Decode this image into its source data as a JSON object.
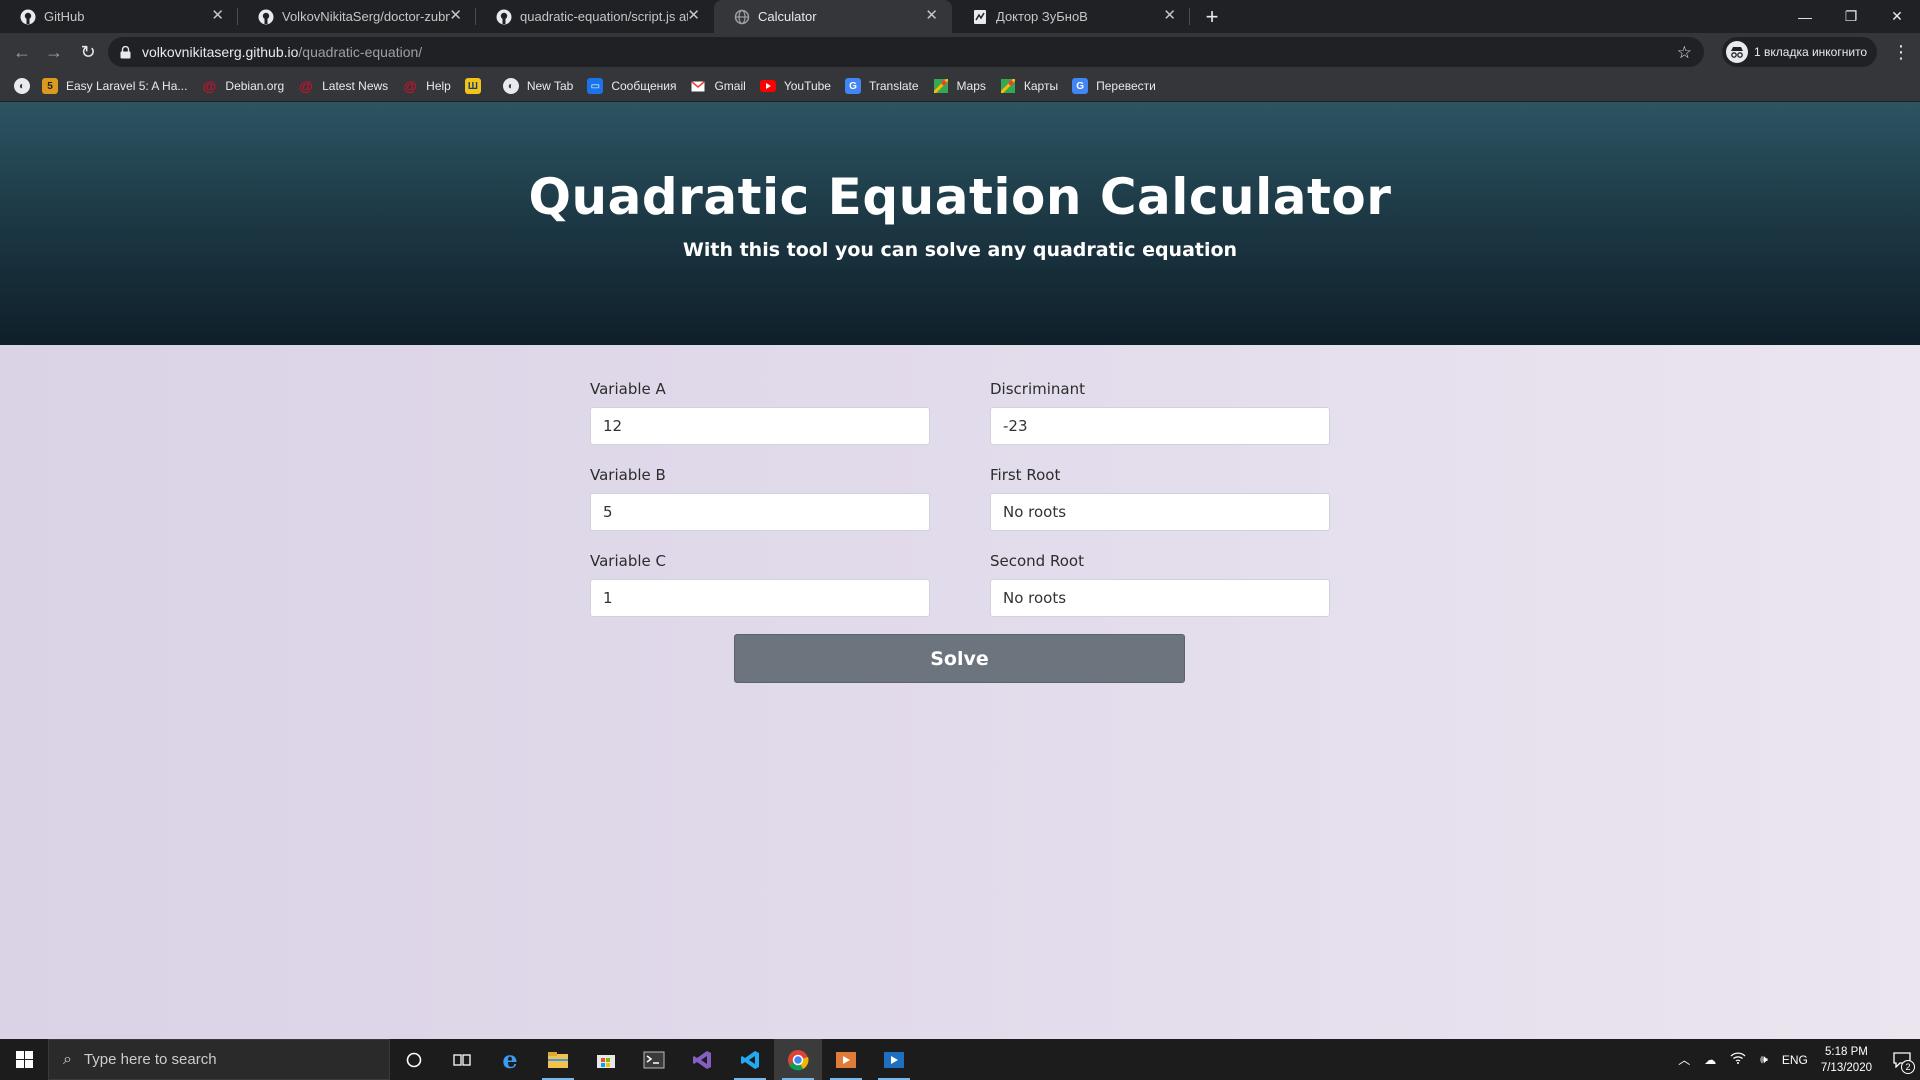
{
  "browser": {
    "tabs": [
      {
        "title": "GitHub",
        "icon": "github-icon",
        "active": false
      },
      {
        "title": "VolkovNikitaSerg/doctor-zubnov",
        "icon": "github-icon",
        "active": false
      },
      {
        "title": "quadratic-equation/script.js at m",
        "icon": "github-icon",
        "active": false
      },
      {
        "title": "Calculator",
        "icon": "globe-icon",
        "active": true
      },
      {
        "title": "Доктор ЗуБноВ",
        "icon": "page-icon",
        "active": false
      }
    ],
    "address": {
      "host": "volkovnikitaserg.github.io",
      "path": "/quadratic-equation/"
    },
    "incognito_label": "1 вкладка инкогнито",
    "bookmarks": [
      {
        "label": "Easy Laravel 5: A Ha...",
        "icon_color": "#d99a1e"
      },
      {
        "label": "Debian.org",
        "icon_color": "#c8102e"
      },
      {
        "label": "Latest News",
        "icon_color": "#c8102e"
      },
      {
        "label": "Help",
        "icon_color": "#c8102e"
      },
      {
        "label": "",
        "icon_color": "#f0c419"
      },
      {
        "label": "New Tab",
        "icon_color": "#e8eaed"
      },
      {
        "label": "Сообщения",
        "icon_color": "#1a73e8"
      },
      {
        "label": "Gmail",
        "icon_color": "#ea4335"
      },
      {
        "label": "YouTube",
        "icon_color": "#ff0000"
      },
      {
        "label": "Translate",
        "icon_color": "#4285f4"
      },
      {
        "label": "Maps",
        "icon_color": "#34a853"
      },
      {
        "label": "Карты",
        "icon_color": "#34a853"
      },
      {
        "label": "Перевести",
        "icon_color": "#4285f4"
      }
    ]
  },
  "page": {
    "title": "Quadratic Equation Calculator",
    "subtitle": "With this tool you can solve any quadratic equation",
    "fields": {
      "a": {
        "label": "Variable A",
        "value": "12"
      },
      "b": {
        "label": "Variable B",
        "value": "5"
      },
      "c": {
        "label": "Variable C",
        "value": "1"
      },
      "discriminant": {
        "label": "Discriminant",
        "value": "-23"
      },
      "root1": {
        "label": "First Root",
        "value": "No roots"
      },
      "root2": {
        "label": "Second Root",
        "value": "No roots"
      }
    },
    "solve_label": "Solve"
  },
  "taskbar": {
    "search_placeholder": "Type here to search",
    "language": "ENG",
    "time": "5:18 PM",
    "date": "7/13/2020",
    "notifications": "2"
  },
  "colors": {
    "hero_top": "#2c5463",
    "hero_bottom": "#0f1f29",
    "content_bg": "#e2dbeb",
    "solve_button": "#6c757d"
  }
}
